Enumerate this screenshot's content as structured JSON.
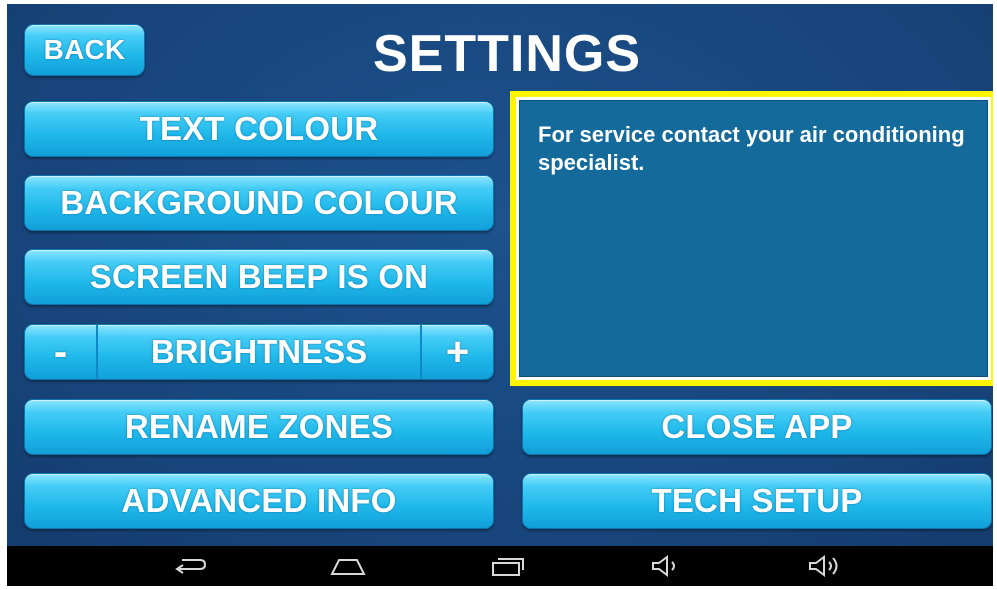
{
  "header": {
    "title": "SETTINGS",
    "back_label": "BACK"
  },
  "left_buttons": {
    "text_colour": "TEXT COLOUR",
    "background_colour": "BACKGROUND COLOUR",
    "screen_beep": "SCREEN BEEP IS ON",
    "brightness_minus": "-",
    "brightness_label": "BRIGHTNESS",
    "brightness_plus": "+",
    "rename_zones": "RENAME ZONES",
    "advanced_info": "ADVANCED INFO"
  },
  "right_buttons": {
    "close_app": "CLOSE APP",
    "tech_setup": "TECH SETUP"
  },
  "info_panel": {
    "message": "For service contact your air conditioning specialist.",
    "highlight_color": "#fff500"
  },
  "navbar": {
    "icons": [
      "back-arrow-icon",
      "home-icon",
      "recent-apps-icon",
      "volume-down-icon",
      "volume-up-icon"
    ]
  },
  "colors": {
    "background": "#17447a",
    "button": "#1fb8ea",
    "panel": "#136a9b"
  }
}
